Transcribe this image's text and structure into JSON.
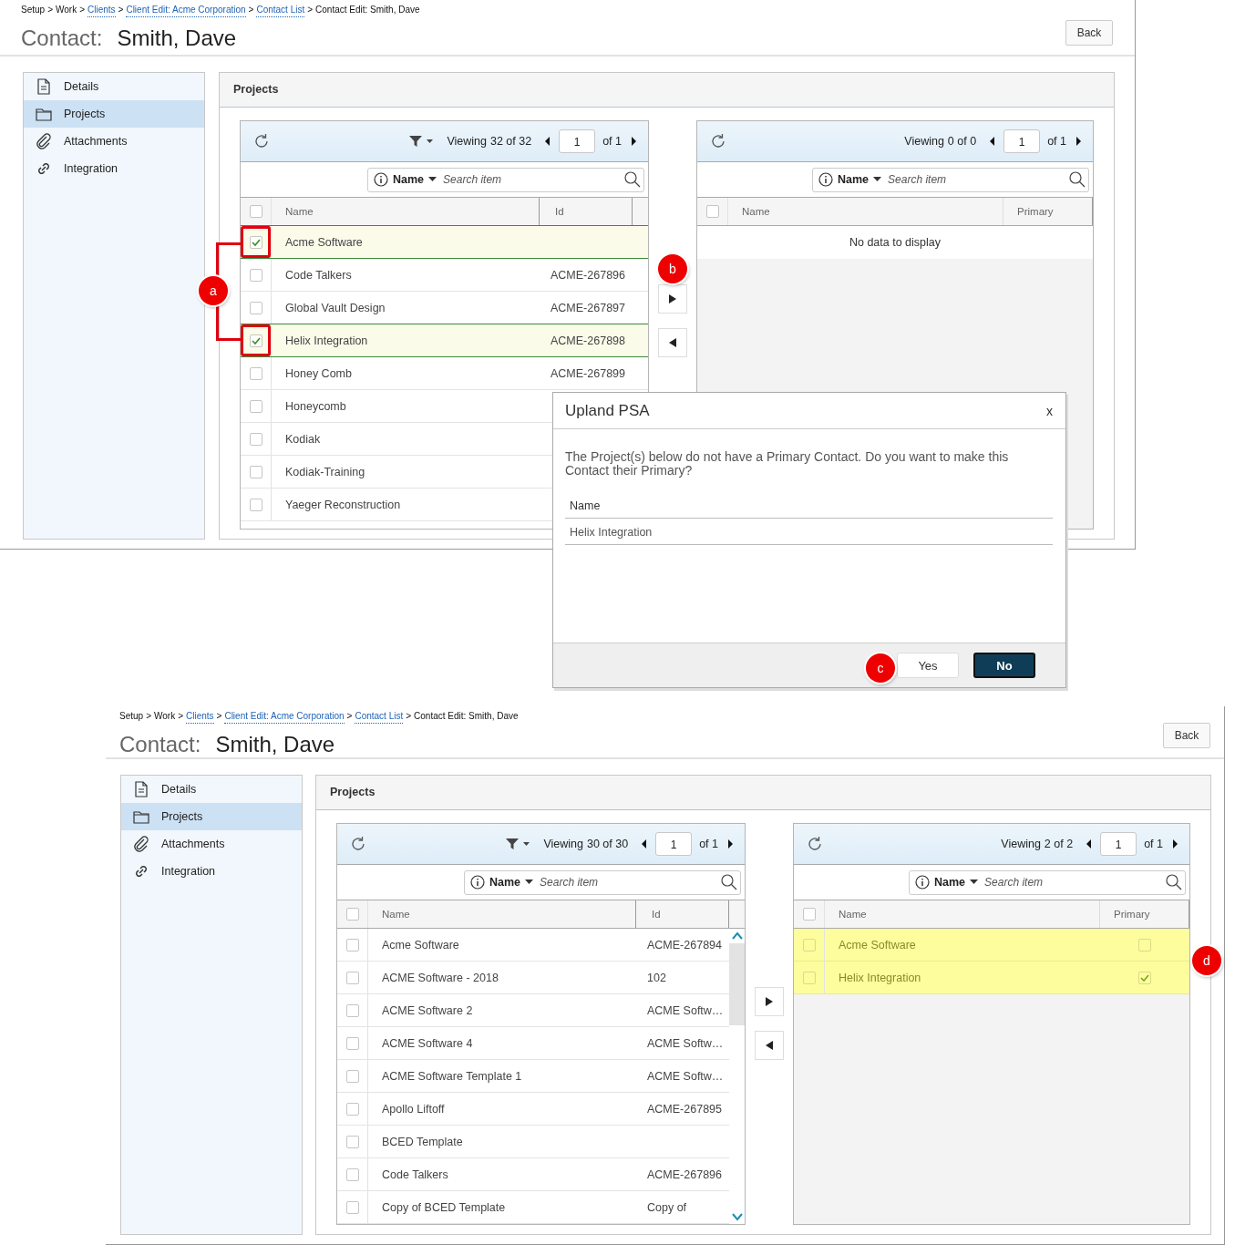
{
  "screens": [
    {
      "breadcrumb": [
        {
          "text": "Setup",
          "link": false
        },
        {
          "text": "Work",
          "link": false
        },
        {
          "text": "Clients",
          "link": true
        },
        {
          "text": "Client Edit: Acme Corporation",
          "link": true
        },
        {
          "text": "Contact List",
          "link": true
        },
        {
          "text": "Contact Edit: Smith, Dave",
          "link": false
        }
      ],
      "breadcrumb_separator": ">",
      "title_label": "Contact:",
      "title_name": "Smith, Dave",
      "back_button": "Back",
      "sidebar": [
        {
          "label": "Details",
          "selected": false
        },
        {
          "label": "Projects",
          "selected": true
        },
        {
          "label": "Attachments",
          "selected": false
        },
        {
          "label": "Integration",
          "selected": false
        }
      ],
      "panel_title": "Projects",
      "available_grid": {
        "filter": true,
        "viewing_label": "Viewing",
        "viewing_count": "32 of 32",
        "page": "1",
        "page_total": "of 1",
        "search_field": "Name",
        "search_placeholder": "Search item",
        "columns": [
          "Name",
          "Id"
        ],
        "all_checked": false,
        "scrollbar": false,
        "callout": "a",
        "rows": [
          {
            "checked": true,
            "selected": true,
            "marked": true,
            "name": "Acme Software"
          },
          {
            "checked": false,
            "selected": false,
            "marked": false,
            "name": "Code Talkers",
            "id": "ACME-267896"
          },
          {
            "checked": false,
            "selected": false,
            "marked": false,
            "name": "Global Vault Design",
            "id": "ACME-267897"
          },
          {
            "checked": true,
            "selected": true,
            "marked": true,
            "name": "Helix Integration",
            "id": "ACME-267898"
          },
          {
            "checked": false,
            "selected": false,
            "marked": false,
            "name": "Honey Comb",
            "id": "ACME-267899"
          },
          {
            "checked": false,
            "selected": false,
            "marked": false,
            "name": "Honeycomb"
          },
          {
            "checked": false,
            "selected": false,
            "marked": false,
            "name": "Kodiak"
          },
          {
            "checked": false,
            "selected": false,
            "marked": false,
            "name": "Kodiak-Training"
          },
          {
            "checked": false,
            "selected": false,
            "marked": false,
            "name": "Yaeger Reconstruction"
          }
        ]
      },
      "move_buttons": [
        {
          "kind": "right",
          "callout": "b"
        },
        {
          "kind": "left"
        }
      ],
      "assigned_grid": {
        "filter": false,
        "viewing_label": "Viewing",
        "viewing_count": "0 of 0",
        "page": "1",
        "page_total": "of 1",
        "search_field": "Name",
        "search_placeholder": "Search item",
        "columns": [
          "Name",
          "Primary"
        ],
        "all_checked": false,
        "empty_text": "No data to display"
      }
    },
    {
      "breadcrumb": [
        {
          "text": "Setup",
          "link": false
        },
        {
          "text": "Work",
          "link": false
        },
        {
          "text": "Clients",
          "link": true
        },
        {
          "text": "Client Edit: Acme Corporation",
          "link": true
        },
        {
          "text": "Contact List",
          "link": true
        },
        {
          "text": "Contact Edit: Smith, Dave",
          "link": false
        }
      ],
      "breadcrumb_separator": ">",
      "title_label": "Contact:",
      "title_name": "Smith, Dave",
      "back_button": "Back",
      "sidebar": [
        {
          "label": "Details",
          "selected": false
        },
        {
          "label": "Projects",
          "selected": true
        },
        {
          "label": "Attachments",
          "selected": false
        },
        {
          "label": "Integration",
          "selected": false
        }
      ],
      "panel_title": "Projects",
      "available_grid": {
        "filter": true,
        "viewing_label": "Viewing",
        "viewing_count": "30 of 30",
        "page": "1",
        "page_total": "of 1",
        "search_field": "Name",
        "search_placeholder": "Search item",
        "columns": [
          "Name",
          "Id"
        ],
        "all_checked": false,
        "scrollbar": true,
        "rows": [
          {
            "checked": false,
            "selected": false,
            "marked": false,
            "name": "Acme Software",
            "id": "ACME-267894"
          },
          {
            "checked": false,
            "selected": false,
            "marked": false,
            "name": "ACME Software - 2018",
            "id": "102"
          },
          {
            "checked": false,
            "selected": false,
            "marked": false,
            "name": "ACME Software 2",
            "id": "ACME Softw…"
          },
          {
            "checked": false,
            "selected": false,
            "marked": false,
            "name": "ACME Software 4",
            "id": "ACME Softw…"
          },
          {
            "checked": false,
            "selected": false,
            "marked": false,
            "name": "ACME Software Template 1",
            "id": "ACME Softw…"
          },
          {
            "checked": false,
            "selected": false,
            "marked": false,
            "name": "Apollo Liftoff",
            "id": "ACME-267895"
          },
          {
            "checked": false,
            "selected": false,
            "marked": false,
            "name": "BCED Template"
          },
          {
            "checked": false,
            "selected": false,
            "marked": false,
            "name": "Code Talkers",
            "id": "ACME-267896"
          },
          {
            "checked": false,
            "selected": false,
            "marked": false,
            "name": "Copy of BCED Template",
            "id": "Copy of"
          }
        ]
      },
      "move_buttons": [
        {
          "kind": "right"
        },
        {
          "kind": "left"
        }
      ],
      "assigned_grid": {
        "filter": false,
        "viewing_label": "Viewing",
        "viewing_count": "2 of 2",
        "page": "1",
        "page_total": "of 1",
        "search_field": "Name",
        "search_placeholder": "Search item",
        "columns": [
          "Name",
          "Primary"
        ],
        "all_checked": false,
        "callout": "d",
        "rows": [
          {
            "checked": false,
            "highlighted": true,
            "name": "Acme Software",
            "primary": false
          },
          {
            "checked": false,
            "highlighted": true,
            "name": "Helix Integration",
            "primary": true
          }
        ]
      }
    }
  ],
  "dialog": {
    "title": "Upland PSA",
    "close": "x",
    "message": "The Project(s) below do not have a Primary Contact. Do you want to make this Contact their Primary?",
    "column": "Name",
    "rows": [
      "Helix Integration"
    ],
    "buttons": [
      {
        "label": "Yes",
        "kind": "secondary",
        "callout": "c"
      },
      {
        "label": "No",
        "kind": "primary"
      }
    ]
  }
}
